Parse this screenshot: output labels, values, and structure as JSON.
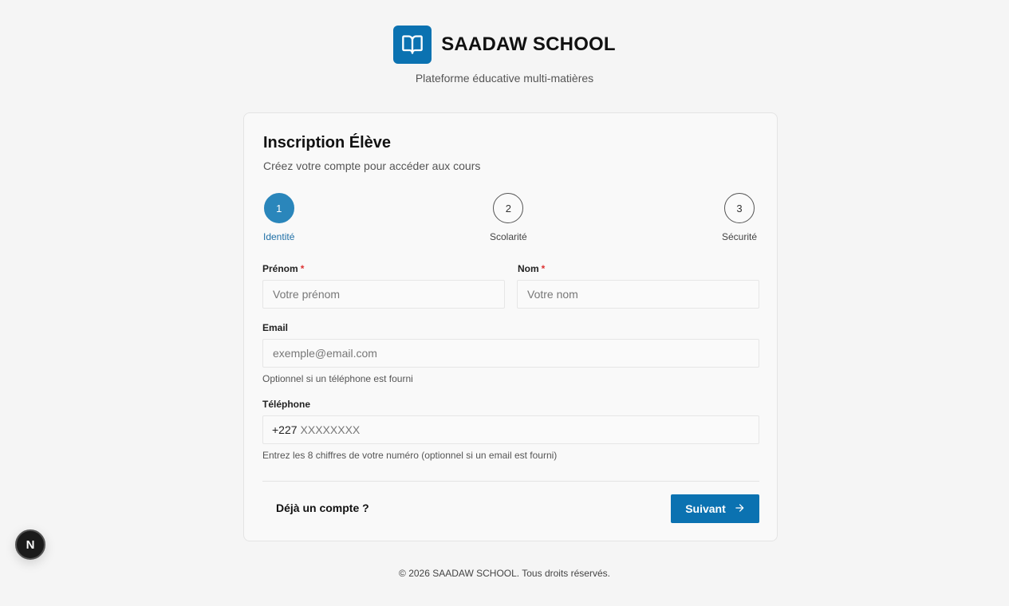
{
  "brand": {
    "name": "SAADAW SCHOOL",
    "tagline": "Plateforme éducative multi-matières",
    "logo_icon": "open-book-icon",
    "accent_color": "#0b72b1"
  },
  "card": {
    "title": "Inscription Élève",
    "subtitle": "Créez votre compte pour accéder aux cours"
  },
  "steps": [
    {
      "number": "1",
      "label": "Identité",
      "active": true
    },
    {
      "number": "2",
      "label": "Scolarité",
      "active": false
    },
    {
      "number": "3",
      "label": "Sécurité",
      "active": false
    }
  ],
  "form": {
    "first_name": {
      "label": "Prénom",
      "required_mark": "*",
      "placeholder": "Votre prénom",
      "value": ""
    },
    "last_name": {
      "label": "Nom",
      "required_mark": "*",
      "placeholder": "Votre nom",
      "value": ""
    },
    "email": {
      "label": "Email",
      "placeholder": "exemple@email.com",
      "value": "",
      "hint": "Optionnel si un téléphone est fourni"
    },
    "phone": {
      "label": "Téléphone",
      "prefix": "+227",
      "placeholder": "XXXXXXXX",
      "value": "",
      "hint": "Entrez les 8 chiffres de votre numéro (optionnel si un email est fourni)"
    }
  },
  "actions": {
    "login_link": "Déjà un compte ?",
    "next_label": "Suivant",
    "next_icon": "arrow-right-icon"
  },
  "footer": "© 2026 SAADAW SCHOOL. Tous droits réservés.",
  "dev_badge": {
    "letter": "N",
    "icon": "nextjs-logo-icon"
  }
}
